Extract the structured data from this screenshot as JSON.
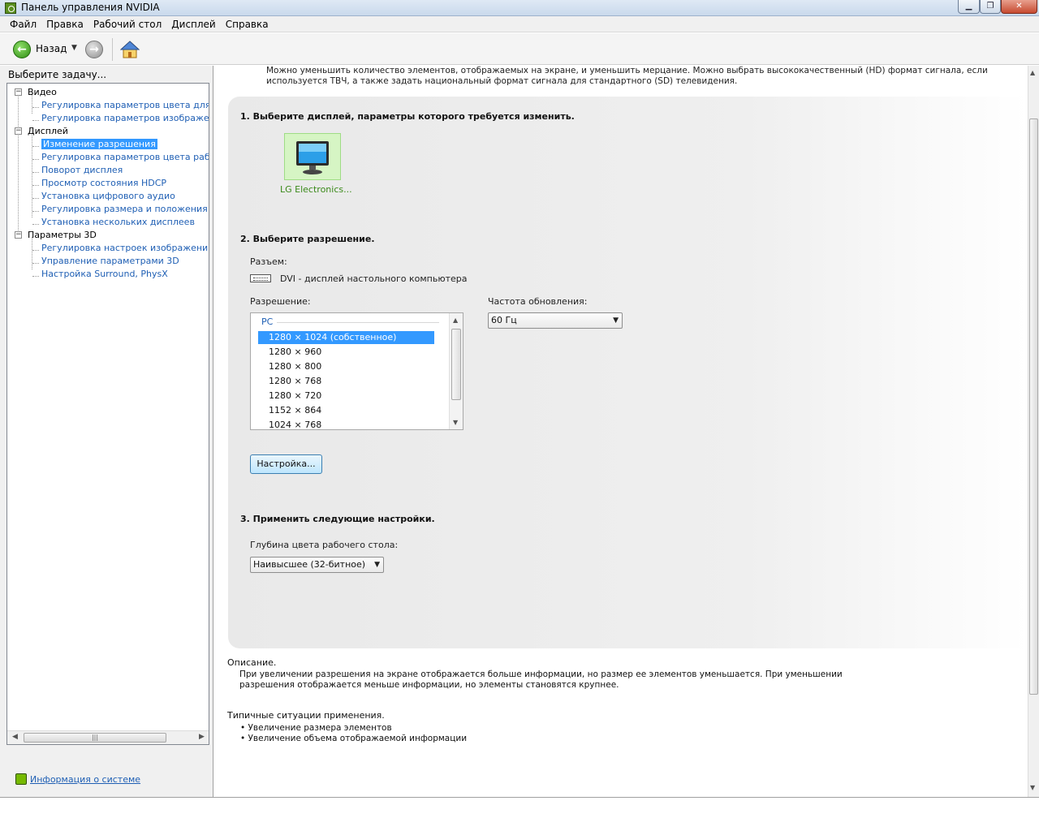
{
  "window": {
    "title": "Панель управления NVIDIA"
  },
  "menu": [
    "Файл",
    "Правка",
    "Рабочий стол",
    "Дисплей",
    "Справка"
  ],
  "toolbar": {
    "back_label": "Назад"
  },
  "left": {
    "task_header": "Выберите задачу...",
    "categories": [
      {
        "label": "Видео",
        "children": [
          {
            "label": "Регулировка параметров цвета для вид"
          },
          {
            "label": "Регулировка параметров изображения д"
          }
        ]
      },
      {
        "label": "Дисплей",
        "children": [
          {
            "label": "Изменение разрешения",
            "selected": true
          },
          {
            "label": "Регулировка параметров цвета рабочег"
          },
          {
            "label": "Поворот дисплея"
          },
          {
            "label": "Просмотр состояния HDCP"
          },
          {
            "label": "Установка цифрового аудио"
          },
          {
            "label": "Регулировка размера и положения рабо"
          },
          {
            "label": "Установка нескольких дисплеев"
          }
        ]
      },
      {
        "label": "Параметры 3D",
        "children": [
          {
            "label": "Регулировка настроек изображения с пр"
          },
          {
            "label": "Управление параметрами 3D"
          },
          {
            "label": "Настройка Surround, PhysX"
          }
        ]
      }
    ],
    "sysinfo_link": "Информация о системе"
  },
  "content": {
    "intro": "Можно уменьшить количество элементов, отображаемых на экране, и уменьшить мерцание. Можно выбрать высококачественный (HD) формат сигнала, если используется ТВЧ, а также задать национальный формат сигнала для стандартного (SD) телевидения.",
    "step1_title": "1. Выберите дисплей, параметры которого требуется изменить.",
    "display_name": "LG Electronics...",
    "step2_title": "2. Выберите разрешение.",
    "connector_label": "Разъем:",
    "connector_value": "DVI - дисплей настольного компьютера",
    "resolution_label": "Разрешение:",
    "resolution_group": "PC",
    "resolutions": [
      {
        "label": "1280 × 1024 (собственное)",
        "selected": true
      },
      {
        "label": "1280 × 960"
      },
      {
        "label": "1280 × 800"
      },
      {
        "label": "1280 × 768"
      },
      {
        "label": "1280 × 720"
      },
      {
        "label": "1152 × 864"
      },
      {
        "label": "1024 × 768"
      }
    ],
    "refresh_label": "Частота обновления:",
    "refresh_value": "60 Гц",
    "customize_button": "Настройка...",
    "step3_title": "3. Применить следующие настройки.",
    "depth_label": "Глубина цвета рабочего стола:",
    "depth_value": "Наивысшее (32-битное)",
    "description_title": "Описание.",
    "description_text": "При увеличении разрешения на экране отображается больше информации, но размер ее элементов уменьшается. При уменьшении разрешения отображается меньше информации, но элементы становятся крупнее.",
    "usage_title": "Типичные ситуации применения.",
    "usage_items": [
      "Увеличение размера элементов",
      "Увеличение объема отображаемой информации"
    ]
  },
  "colors": {
    "accent": "#3399ff",
    "link": "#1f5fb4",
    "nvidia_green": "#76b900"
  }
}
